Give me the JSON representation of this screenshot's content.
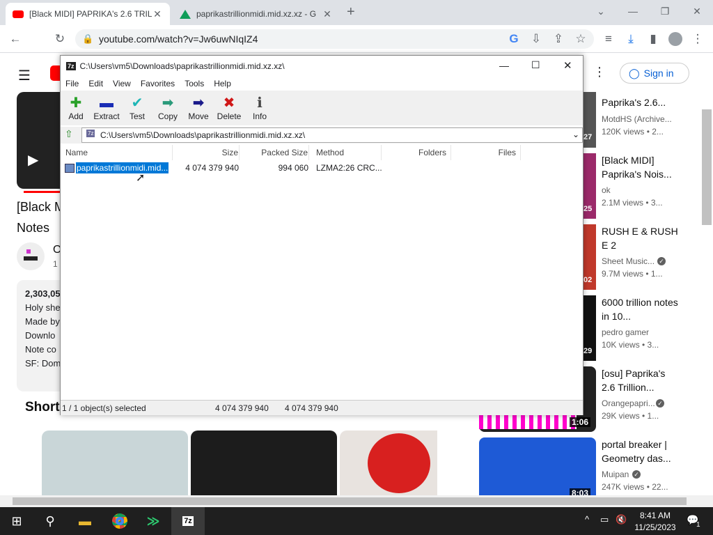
{
  "browser": {
    "tabs": [
      {
        "title": "[Black MIDI] PAPRIKA's 2.6 TRILLI",
        "icon": "youtube-icon"
      },
      {
        "title": "paprikastrillionmidi.mid.xz.xz - G",
        "icon": "drive-icon"
      }
    ],
    "url": "youtube.com/watch?v=Jw6uwNIqIZ4"
  },
  "youtube": {
    "sign_in": "Sign in",
    "video_title_line1": "[Black M",
    "video_title_line2": "Notes",
    "channel_initial": "O",
    "channel_sub": "1",
    "desc_views": "2,303,05",
    "desc_lines": [
      "Holy she",
      "Made by",
      "Downlo",
      "Note co",
      "SF: Dom"
    ],
    "shorts_label": "Short",
    "sidebar": [
      {
        "title": "Paprika's 2.6...",
        "channel": "MotdHS (Archive...",
        "meta": "120K views  • 2...",
        "duration": "27"
      },
      {
        "title": "[Black MIDI] Paprika's Nois...",
        "channel": "ok",
        "meta": "2.1M views  • 3...",
        "duration": "25"
      },
      {
        "title": "RUSH E & RUSH E 2",
        "channel": "Sheet Music...",
        "meta": "9.7M views  • 1...",
        "duration": "02"
      },
      {
        "title": "6000 trillion notes in 10...",
        "channel": "pedro gamer",
        "meta": "10K views  • 3...",
        "duration": "29"
      },
      {
        "title": "[osu] Paprika's 2.6 Trillion...",
        "channel": "Orangepapri...",
        "meta": "29K views  • 1...",
        "duration": "1:06"
      },
      {
        "title": "portal breaker | Geometry das...",
        "channel": "Muipan",
        "meta": "247K views  • 22...",
        "duration": "8:03"
      }
    ]
  },
  "sevenzip": {
    "title": "C:\\Users\\vm5\\Downloads\\paprikastrillionmidi.mid.xz.xz\\",
    "menu": [
      "File",
      "Edit",
      "View",
      "Favorites",
      "Tools",
      "Help"
    ],
    "tools": [
      {
        "label": "Add",
        "icon": "plus-icon",
        "glyph": "✚",
        "color": "#2aa12a"
      },
      {
        "label": "Extract",
        "icon": "minus-icon",
        "glyph": "▬",
        "color": "#1a2db5"
      },
      {
        "label": "Test",
        "icon": "check-icon",
        "glyph": "✔",
        "color": "#1fb6b6"
      },
      {
        "label": "Copy",
        "icon": "copy-arrow-icon",
        "glyph": "➡",
        "color": "#2a9a7a"
      },
      {
        "label": "Move",
        "icon": "move-arrow-icon",
        "glyph": "➡",
        "color": "#1a1a8a"
      },
      {
        "label": "Delete",
        "icon": "delete-x-icon",
        "glyph": "✖",
        "color": "#d01818"
      },
      {
        "label": "Info",
        "icon": "info-icon",
        "glyph": "ℹ",
        "color": "#444"
      }
    ],
    "address": "C:\\Users\\vm5\\Downloads\\paprikastrillionmidi.mid.xz.xz\\",
    "columns": [
      "Name",
      "Size",
      "Packed Size",
      "Method",
      "Folders",
      "Files"
    ],
    "rows": [
      {
        "name": "paprikastrillionmidi.mid...",
        "size": "4 074 379 940",
        "packed": "994 060",
        "method": "LZMA2:26 CRC..."
      }
    ],
    "status": {
      "selected": "1 / 1 object(s) selected",
      "size": "4 074 379 940",
      "packed": "4 074 379 940"
    }
  },
  "taskbar": {
    "time": "8:41 AM",
    "date": "11/25/2023",
    "notifications": "1"
  },
  "colors": {
    "accent": "#1a73e8",
    "youtube_red": "#ff0000",
    "selection": "#0078d7"
  }
}
